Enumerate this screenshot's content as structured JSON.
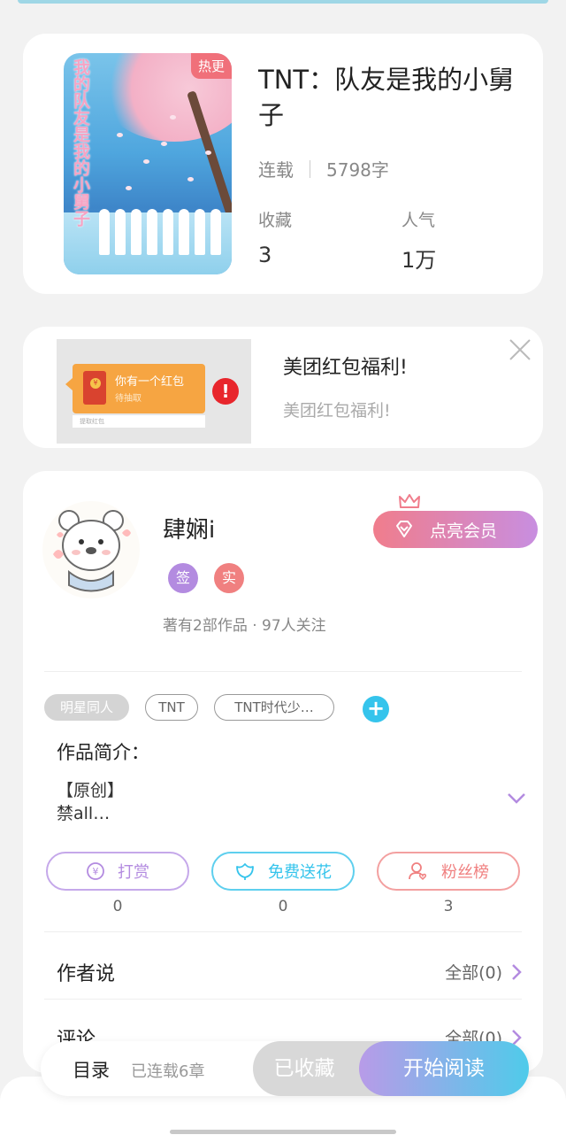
{
  "book": {
    "hot_badge": "热更",
    "cover_text": "我的队友是我的小舅子",
    "title": "TNT：队友是我的小舅子",
    "status": "连载",
    "word_count": "5798字",
    "stats": [
      {
        "label": "收藏",
        "value": "3"
      },
      {
        "label": "人气",
        "value": "1万"
      }
    ]
  },
  "ad": {
    "bubble_title": "你有一个红包",
    "bubble_sub": "待抽取",
    "strip_text": "提取红包",
    "exclaim": "!",
    "title": "美团红包福利!",
    "subtitle": "美团红包福利!"
  },
  "author": {
    "name": "肆娴i",
    "vip_button": "点亮会员",
    "badges": [
      {
        "label": "签",
        "color": "#b38be0"
      },
      {
        "label": "实",
        "color": "#f08080"
      }
    ],
    "stats": "著有2部作品 · 97人关注"
  },
  "tags": [
    "明星同人",
    "TNT",
    "TNT时代少…"
  ],
  "tag_add": "+",
  "intro": {
    "label": "作品简介：",
    "lines": [
      "【原创】",
      "禁all…"
    ]
  },
  "actions": [
    {
      "label": "打赏",
      "count": "0",
      "color": "#b38be0"
    },
    {
      "label": "免费送花",
      "count": "0",
      "color": "#35c4ec"
    },
    {
      "label": "粉丝榜",
      "count": "3",
      "color": "#f08080"
    }
  ],
  "rows": [
    {
      "title": "作者说",
      "right": "全部(0)"
    },
    {
      "title": "评论",
      "right": "全部(0)"
    }
  ],
  "bottom": {
    "toc": "目录",
    "serial": "已连载6章",
    "collected": "已收藏",
    "read": "开始阅读"
  }
}
